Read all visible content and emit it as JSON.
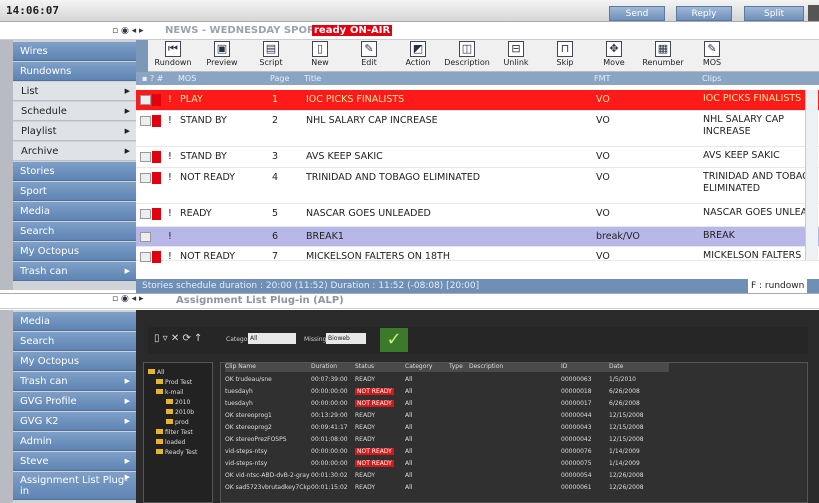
{
  "clock": "14:06:07",
  "top_buttons": [
    "Send",
    "Reply",
    "Split"
  ],
  "rundown_header": {
    "title": "NEWS - WEDNESDAY SPORTS",
    "ready": "ready",
    "onair": "ON-AIR"
  },
  "sidebar_top": [
    {
      "label": "Wires",
      "sub": false
    },
    {
      "label": "Rundowns",
      "sub": false
    },
    {
      "label": "List",
      "sub": true
    },
    {
      "label": "Schedule",
      "sub": true
    },
    {
      "label": "Playlist",
      "sub": true
    },
    {
      "label": "Archive",
      "sub": true
    },
    {
      "label": "Stories",
      "sub": false
    },
    {
      "label": "Sport",
      "sub": false
    },
    {
      "label": "Media",
      "sub": false
    },
    {
      "label": "Search",
      "sub": false
    },
    {
      "label": "My Octopus",
      "sub": false
    },
    {
      "label": "Trash can",
      "sub": false
    }
  ],
  "toolbar": [
    "Rundown",
    "Preview",
    "Script",
    "New",
    "Edit",
    "Action",
    "Description",
    "Unlink",
    "Skip",
    "Move",
    "Renumber",
    "MOS"
  ],
  "columns": {
    "mos": "MOS",
    "page": "Page",
    "title": "Title",
    "fmt": "FMT",
    "clips": "Clips"
  },
  "rows": [
    {
      "mos": "PLAY",
      "page": "1",
      "title": "IOC PICKS FINALISTS",
      "fmt": "VO",
      "clips": "IOC PICKS FINALISTS",
      "state": "play"
    },
    {
      "mos": "STAND BY",
      "page": "2",
      "title": "NHL SALARY CAP INCREASE",
      "fmt": "VO",
      "clips": "NHL SALARY CAP INCREASE",
      "state": "normal"
    },
    {
      "mos": "STAND BY",
      "page": "3",
      "title": "AVS KEEP SAKIC",
      "fmt": "VO",
      "clips": "AVS KEEP SAKIC",
      "state": "normal"
    },
    {
      "mos": "NOT READY",
      "page": "4",
      "title": "TRINIDAD AND TOBAGO ELIMINATED",
      "fmt": "VO",
      "clips": "TRINIDAD AND TOBAG ELIMINATED",
      "state": "normal"
    },
    {
      "mos": "READY",
      "page": "5",
      "title": "NASCAR GOES UNLEADED",
      "fmt": "VO",
      "clips": "NASCAR GOES UNLEA",
      "state": "normal"
    },
    {
      "mos": "",
      "page": "6",
      "title": "BREAK1",
      "fmt": "break/VO",
      "clips": "BREAK",
      "state": "break"
    },
    {
      "mos": "NOT READY",
      "page": "7",
      "title": "MICKELSON FALTERS ON 18TH",
      "fmt": "VO",
      "clips": "MICKELSON FALTERS",
      "state": "normal"
    }
  ],
  "status": "Stories schedule duration : 20:00 (11:52) Duration : 11:52 (-08:08) [20:00]",
  "status_right": "F : rundown",
  "plugin_header": "Assignment List Plug-in (ALP)",
  "sidebar_bottom": [
    "Media",
    "Search",
    "My Octopus",
    "Trash can",
    "GVG Profile",
    "GVG K2",
    "Admin",
    "Steve",
    "Assignment List Plug-in"
  ],
  "alp": {
    "category_label": "Category",
    "category_value": "All",
    "missing_label": "Missing",
    "missing_value": "Bioweb",
    "grid_headers": [
      "Clip Name",
      "Duration",
      "Status",
      "Category",
      "Type",
      "Description",
      "ID",
      "Date"
    ],
    "grid_rows": [
      {
        "name": "OK trudeau/sne",
        "dur": "00:07:39:00",
        "status": "READY",
        "cat": "All",
        "id": "00000063",
        "date": "1/5/2010"
      },
      {
        "name": "tuesdayh",
        "dur": "00:00:00:00",
        "status": "NOT READY",
        "cat": "All",
        "id": "00000018",
        "date": "6/26/2008"
      },
      {
        "name": "tuesdayh",
        "dur": "00:00:00:00",
        "status": "NOT READY",
        "cat": "All",
        "id": "00000017",
        "date": "6/26/2008"
      },
      {
        "name": "OK stereoprog1",
        "dur": "00:13:29:00",
        "status": "READY",
        "cat": "All",
        "id": "00000044",
        "date": "12/15/2008"
      },
      {
        "name": "OK stereoprog2",
        "dur": "00:09:41:17",
        "status": "READY",
        "cat": "All",
        "id": "00000043",
        "date": "12/15/2008"
      },
      {
        "name": "OK stereoPrezFOSPS",
        "dur": "00:01:08:00",
        "status": "READY",
        "cat": "All",
        "id": "00000042",
        "date": "12/15/2008"
      },
      {
        "name": "vid-steps-ntsy",
        "dur": "00:00:00:00",
        "status": "NOT READY",
        "cat": "All",
        "id": "00000076",
        "date": "1/14/2009"
      },
      {
        "name": "vid-steps-ntsy",
        "dur": "00:00:00:00",
        "status": "NOT READY",
        "cat": "All",
        "id": "00000075",
        "date": "1/14/2009"
      },
      {
        "name": "OK vid-ntsc-ABD-dvB-2-gray",
        "dur": "00:01:30:02",
        "status": "READY",
        "cat": "All",
        "id": "00000054",
        "date": "12/26/2008"
      },
      {
        "name": "OK sad5723vbrutadkey7Ckp",
        "dur": "00:01:15:02",
        "status": "READY",
        "cat": "All",
        "id": "00000061",
        "date": "12/26/2008"
      }
    ],
    "tree": [
      "All",
      "Prod Test",
      "k-mail",
      "2010",
      "2010b",
      "prod",
      "filter Test",
      "loaded",
      "Ready Test"
    ]
  },
  "colors": {
    "accent": "#6f90bb",
    "play_row": "#ff1a1a",
    "break_row": "#b8b8e8",
    "flag": "#e00010",
    "not_ready": "#d21a1a"
  },
  "icons": {
    "flag": "red-flag-icon",
    "logo": "gv-checkmark-logo"
  }
}
